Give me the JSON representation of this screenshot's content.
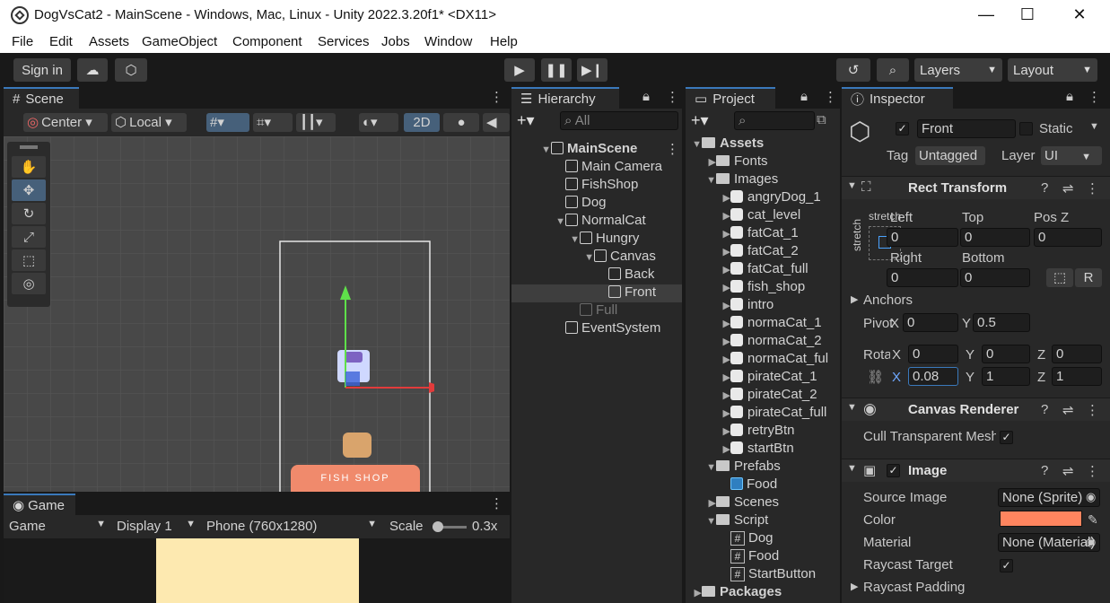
{
  "window": {
    "title": "DogVsCat2 - MainScene - Windows, Mac, Linux - Unity 2022.3.20f1* <DX11>",
    "minimize": "—",
    "maximize": "☐",
    "close": "✕"
  },
  "menu": [
    "File",
    "Edit",
    "Assets",
    "GameObject",
    "Component",
    "Services",
    "Jobs",
    "Window",
    "Help"
  ],
  "toolbar": {
    "sign_in": "Sign in",
    "layers": "Layers",
    "layout": "Layout"
  },
  "scene": {
    "tab": "Scene",
    "pivot": "Center",
    "space": "Local",
    "mode_2d": "2D",
    "shop_sign": "FISH SHOP"
  },
  "game": {
    "tab": "Game",
    "view": "Game",
    "display": "Display 1",
    "resolution": "Phone (760x1280)",
    "scale_label": "Scale",
    "scale_value": "0.3x"
  },
  "hierarchy": {
    "tab": "Hierarchy",
    "search_placeholder": "All",
    "items": [
      {
        "label": "MainScene",
        "depth": 0,
        "arrow": "▼",
        "bold": true
      },
      {
        "label": "Main Camera",
        "depth": 1,
        "arrow": ""
      },
      {
        "label": "FishShop",
        "depth": 1,
        "arrow": ""
      },
      {
        "label": "Dog",
        "depth": 1,
        "arrow": ""
      },
      {
        "label": "NormalCat",
        "depth": 1,
        "arrow": "▼"
      },
      {
        "label": "Hungry",
        "depth": 2,
        "arrow": "▼"
      },
      {
        "label": "Canvas",
        "depth": 3,
        "arrow": "▼"
      },
      {
        "label": "Back",
        "depth": 4,
        "arrow": ""
      },
      {
        "label": "Front",
        "depth": 4,
        "arrow": "",
        "selected": true
      },
      {
        "label": "Full",
        "depth": 2,
        "arrow": "",
        "dim": true
      },
      {
        "label": "EventSystem",
        "depth": 1,
        "arrow": ""
      }
    ]
  },
  "project": {
    "tab": "Project",
    "items": [
      {
        "label": "Assets",
        "depth": 0,
        "type": "folder",
        "arrow": "▼",
        "bold": true
      },
      {
        "label": "Fonts",
        "depth": 1,
        "type": "folder",
        "arrow": "▶"
      },
      {
        "label": "Images",
        "depth": 1,
        "type": "folder",
        "arrow": "▼"
      },
      {
        "label": "angryDog_1",
        "depth": 2,
        "type": "img",
        "arrow": "▶"
      },
      {
        "label": "cat_level",
        "depth": 2,
        "type": "img",
        "arrow": "▶"
      },
      {
        "label": "fatCat_1",
        "depth": 2,
        "type": "img",
        "arrow": "▶"
      },
      {
        "label": "fatCat_2",
        "depth": 2,
        "type": "img",
        "arrow": "▶"
      },
      {
        "label": "fatCat_full",
        "depth": 2,
        "type": "img",
        "arrow": "▶"
      },
      {
        "label": "fish_shop",
        "depth": 2,
        "type": "img",
        "arrow": "▶"
      },
      {
        "label": "intro",
        "depth": 2,
        "type": "img",
        "arrow": "▶"
      },
      {
        "label": "normaCat_1",
        "depth": 2,
        "type": "img",
        "arrow": "▶"
      },
      {
        "label": "normaCat_2",
        "depth": 2,
        "type": "img",
        "arrow": "▶"
      },
      {
        "label": "normaCat_ful",
        "depth": 2,
        "type": "img",
        "arrow": "▶"
      },
      {
        "label": "pirateCat_1",
        "depth": 2,
        "type": "img",
        "arrow": "▶"
      },
      {
        "label": "pirateCat_2",
        "depth": 2,
        "type": "img",
        "arrow": "▶"
      },
      {
        "label": "pirateCat_full",
        "depth": 2,
        "type": "img",
        "arrow": "▶"
      },
      {
        "label": "retryBtn",
        "depth": 2,
        "type": "img",
        "arrow": "▶"
      },
      {
        "label": "startBtn",
        "depth": 2,
        "type": "img",
        "arrow": "▶"
      },
      {
        "label": "Prefabs",
        "depth": 1,
        "type": "folder",
        "arrow": "▼"
      },
      {
        "label": "Food",
        "depth": 2,
        "type": "prefab",
        "arrow": ""
      },
      {
        "label": "Scenes",
        "depth": 1,
        "type": "folder",
        "arrow": "▶"
      },
      {
        "label": "Script",
        "depth": 1,
        "type": "folder",
        "arrow": "▼"
      },
      {
        "label": "Dog",
        "depth": 2,
        "type": "script",
        "arrow": ""
      },
      {
        "label": "Food",
        "depth": 2,
        "type": "script",
        "arrow": ""
      },
      {
        "label": "StartButton",
        "depth": 2,
        "type": "script",
        "arrow": ""
      },
      {
        "label": "Packages",
        "depth": 0,
        "type": "folder",
        "arrow": "▶",
        "bold": true
      }
    ]
  },
  "inspector": {
    "tab": "Inspector",
    "object_name": "Front",
    "static_label": "Static",
    "tag_label": "Tag",
    "tag_value": "Untagged",
    "layer_label": "Layer",
    "layer_value": "UI",
    "rect": {
      "title": "Rect Transform",
      "anchor_h": "stretch",
      "anchor_v": "stretch",
      "left_label": "Left",
      "left": "0",
      "top_label": "Top",
      "top": "0",
      "posz_label": "Pos Z",
      "posz": "0",
      "right_label": "Right",
      "right": "0",
      "bottom_label": "Bottom",
      "bottom": "0",
      "r_btn": "R",
      "anchors_label": "Anchors",
      "pivot_label": "Pivot",
      "pivot_x": "0",
      "pivot_y": "0.5",
      "rotation_label": "Rotation",
      "rot_x": "0",
      "rot_y": "0",
      "rot_z": "0",
      "scale_x": "0.08",
      "scale_y": "1",
      "scale_z": "1"
    },
    "canvas_renderer": {
      "title": "Canvas Renderer",
      "cull_label": "Cull Transparent Mesh"
    },
    "image": {
      "title": "Image",
      "source_label": "Source Image",
      "source_value": "None (Sprite)",
      "color_label": "Color",
      "color_value": "#ff855f",
      "material_label": "Material",
      "material_value": "None (Material)",
      "raycast_target_label": "Raycast Target",
      "raycast_padding_label": "Raycast Padding"
    }
  }
}
